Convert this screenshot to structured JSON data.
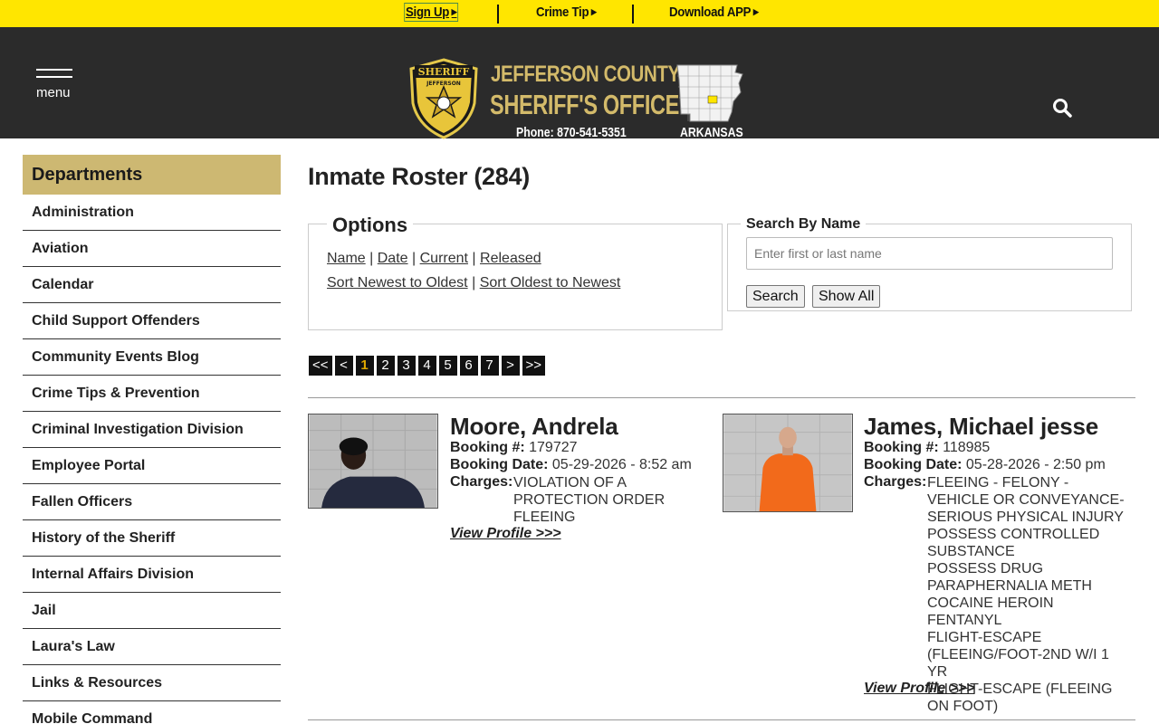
{
  "topbar": {
    "signup": "Sign Up",
    "crime_tip": "Crime Tip",
    "download_app": "Download APP"
  },
  "header": {
    "menu_label": "menu",
    "title_line1": "JEFFERSON COUNTY",
    "title_line2": "SHERIFF'S OFFICE",
    "phone": "Phone: 870-541-5351",
    "state": "ARKANSAS",
    "badge_top": "SHERIFF",
    "badge_arc": "JEFFERSON",
    "icons": [
      "menu-icon",
      "sheriff-badge-logo",
      "arkansas-map",
      "search-icon"
    ],
    "colors": {
      "accent_gold": "#d3ba6a",
      "topbar_yellow": "#ffe600",
      "header_bg": "#2b2b2b"
    }
  },
  "sidebar": {
    "heading": "Departments",
    "items": [
      "Administration",
      "Aviation",
      "Calendar",
      "Child Support Offenders",
      "Community Events Blog",
      "Crime Tips & Prevention",
      "Criminal Investigation Division",
      "Employee Portal",
      "Fallen Officers",
      "History of the Sheriff",
      "Internal Affairs Division",
      "Jail",
      "Laura's Law",
      "Links & Resources",
      "Mobile Command"
    ]
  },
  "main": {
    "title": "Inmate Roster (284)",
    "options": {
      "legend": "Options",
      "row1": [
        "Name",
        "Date",
        "Current",
        "Released"
      ],
      "row2": [
        "Sort Newest to Oldest",
        "Sort Oldest to Newest"
      ],
      "separator": "|"
    },
    "search": {
      "legend": "Search By Name",
      "placeholder": "Enter first or last name",
      "value": "",
      "search_button": "Search",
      "show_all_button": "Show All"
    },
    "pagination": {
      "first": "<<",
      "prev": "<",
      "pages": [
        "1",
        "2",
        "3",
        "4",
        "5",
        "6",
        "7"
      ],
      "current": "1",
      "next": ">",
      "last": ">>"
    },
    "labels": {
      "booking_number": "Booking #:",
      "booking_date": "Booking Date:",
      "charges": "Charges:",
      "view_profile": "View Profile >>>"
    },
    "inmates": [
      {
        "name": "Moore, Andrela",
        "booking_number": "179727",
        "booking_date": "05-29-2026 - 8:52 am",
        "charges": [
          "VIOLATION OF A PROTECTION ORDER",
          "FLEEING"
        ]
      },
      {
        "name": "James, Michael jesse",
        "booking_number": "118985",
        "booking_date": "05-28-2026 - 2:50 pm",
        "charges": [
          "FLEEING - FELONY -VEHICLE OR CONVEYANCE- SERIOUS PHYSICAL INJURY",
          "POSSESS CONTROLLED SUBSTANCE",
          "POSSESS DRUG PARAPHERNALIA METH COCAINE HEROIN FENTANYL",
          "FLIGHT-ESCAPE (FLEEING/FOOT-2ND W/I 1 YR",
          "FLIGHT-ESCAPE (FLEEING ON FOOT)"
        ]
      }
    ]
  }
}
